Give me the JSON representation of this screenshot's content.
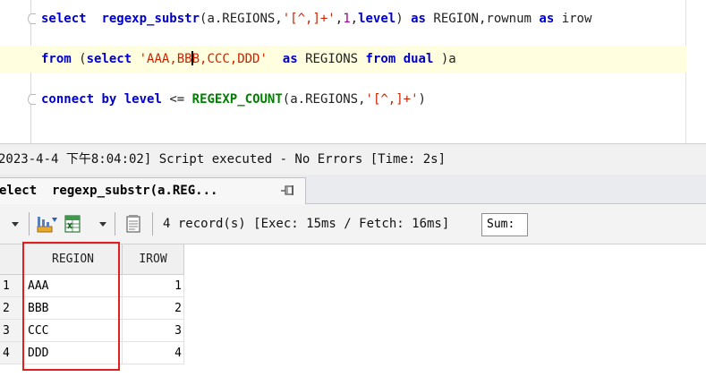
{
  "editor": {
    "line1": {
      "t1": "select",
      "t2": "regexp_substr",
      "t3": "(a.REGIONS,",
      "t4": "'[^,]+'",
      "t5": ",",
      "t6": "1",
      "t7": ",",
      "t8": "level",
      "t9": ")",
      "t10": "as",
      "t11": "REGION,rownum",
      "t12": "as",
      "t13": "irow"
    },
    "line2": {
      "t1": "from",
      "t2": "(",
      "t3": "select",
      "t4a": "'AAA,BB",
      "t4b": "B,CCC,DDD'",
      "t5": "as",
      "t6": "REGIONS",
      "t7": "from",
      "t8": "dual",
      "t9": ")a"
    },
    "line3": {
      "t1": "connect",
      "t2": "by",
      "t3": "level",
      "t4": "<=",
      "t5": "REGEXP_COUNT",
      "t6": "(a.REGIONS,",
      "t7": "'[^,]+'",
      "t8": ")"
    }
  },
  "status": {
    "message": "2023-4-4 下午8:04:02] Script executed - No Errors [Time: 2s]"
  },
  "result_tab": {
    "label": "elect  regexp_substr(a.REG..."
  },
  "toolbar": {
    "records": "4 record(s) [Exec: 15ms / Fetch: 16ms]",
    "sum_label": "Sum:"
  },
  "grid": {
    "columns": [
      "REGION",
      "IROW"
    ],
    "rows": [
      {
        "num": "1",
        "region": "AAA",
        "irow": "1"
      },
      {
        "num": "2",
        "region": "BBB",
        "irow": "2"
      },
      {
        "num": "3",
        "region": "CCC",
        "irow": "3"
      },
      {
        "num": "4",
        "region": "DDD",
        "irow": "4"
      }
    ]
  },
  "colors": {
    "keyword": "#0000cc",
    "function": "#008000",
    "string": "#cc2200",
    "number": "#a000a0",
    "highlight_box": "#e02020"
  }
}
